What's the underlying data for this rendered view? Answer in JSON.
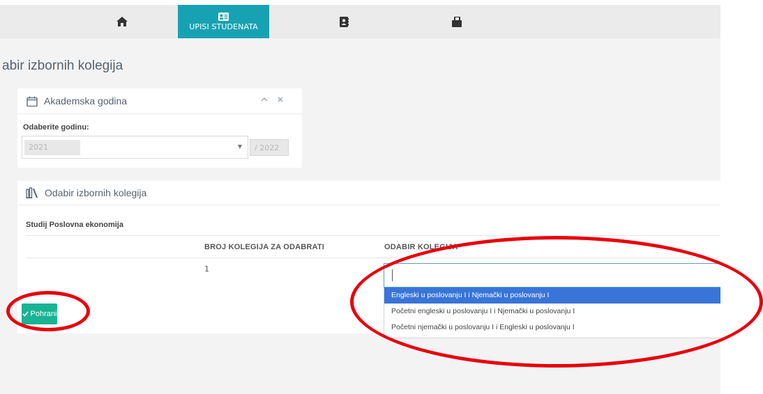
{
  "navbar": {
    "items": [
      {
        "icon": "home-icon",
        "label": ""
      },
      {
        "icon": "id-card-icon",
        "label": "UPISI STUDENATA",
        "active": true
      },
      {
        "icon": "contact-book-icon",
        "label": ""
      },
      {
        "icon": "briefcase-icon",
        "label": ""
      }
    ],
    "active_color": "#17a2b3"
  },
  "page": {
    "title": "abir izbornih kolegija"
  },
  "year_panel": {
    "title": "Akademska godina",
    "field_label": "Odaberite godinu:",
    "year_start": "2021",
    "year_end": "/ 2022"
  },
  "courses_panel": {
    "title": "Odabir izbornih kolegija",
    "study": "Studij Poslovna ekonomija",
    "columns": [
      "BROJ KOLEGIJA ZA ODABRATI",
      "ODABIR KOLEGIJA"
    ],
    "count_value": "1",
    "save_label": "Pohrani",
    "save_color": "#1ab394"
  },
  "dropdown": {
    "search_value": "",
    "options": [
      "Engleski u poslovanju I i Njemački u poslovanju I",
      "Početni engleski u poslovanju I i Njemački u poslovanju I",
      "Početni njemački u poslovanju I i Engleski u poslovanju I"
    ],
    "highlight_color": "#3875d7"
  },
  "annotation_color": "#e8000b"
}
